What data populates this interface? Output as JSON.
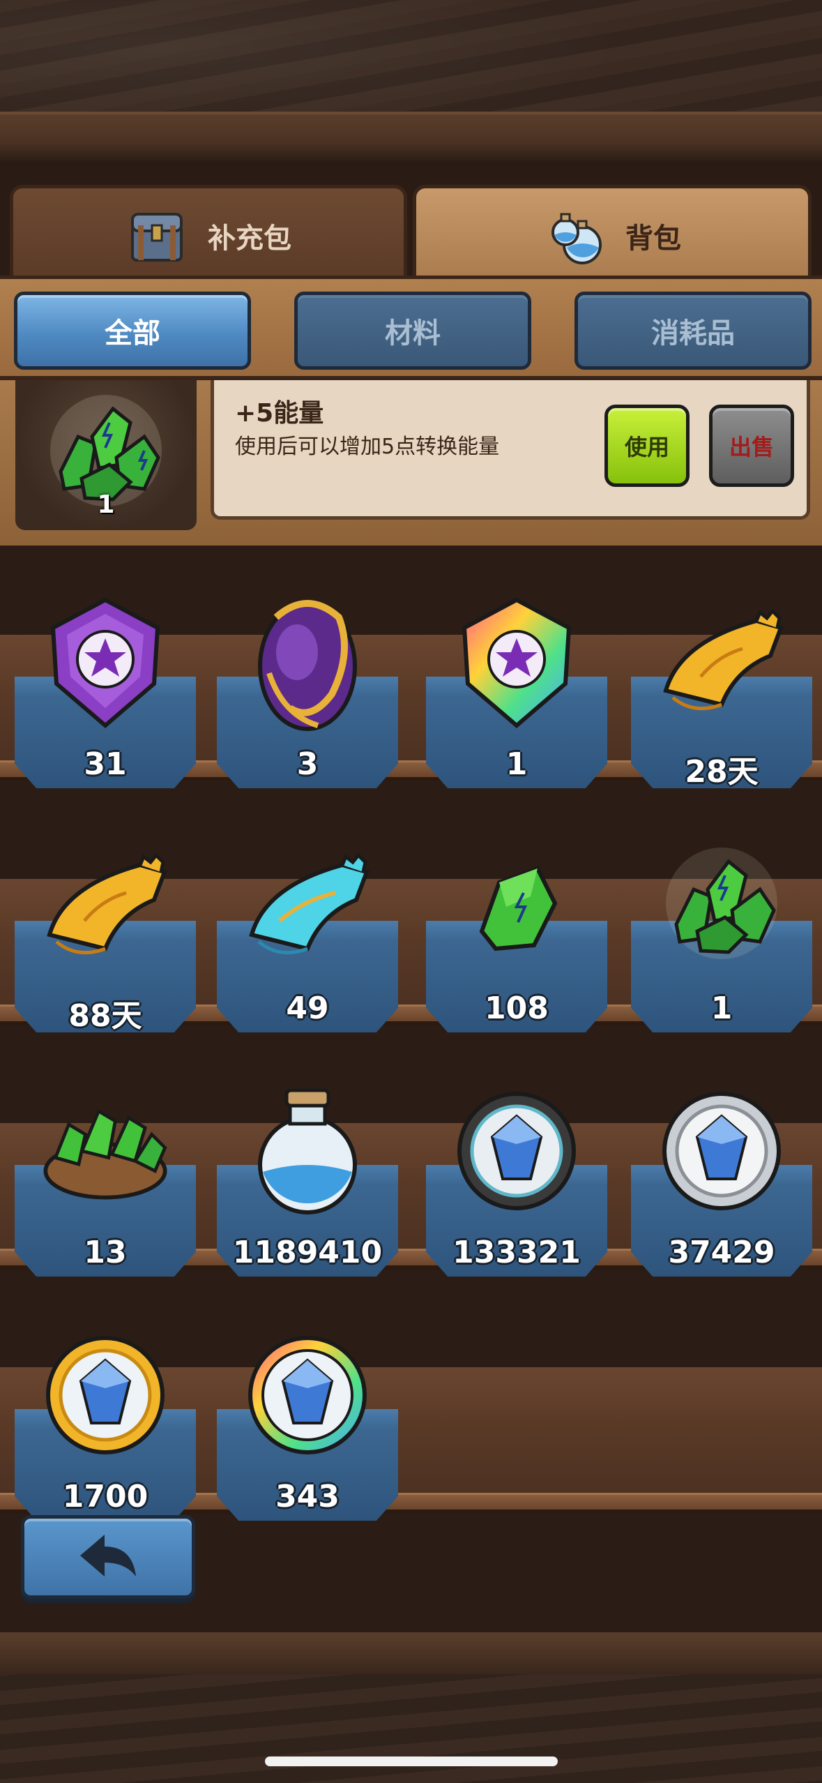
{
  "tabs": {
    "supply_label": "补充包",
    "bag_label": "背包",
    "active": "背包"
  },
  "filters": [
    {
      "label": "全部",
      "active": true
    },
    {
      "label": "材料",
      "active": false
    },
    {
      "label": "消耗品",
      "active": false
    }
  ],
  "detail": {
    "icon": "green-crystal-pile-icon",
    "count": "1",
    "title": "+5能量",
    "description": "使用后可以增加5点转换能量",
    "use_label": "使用",
    "sell_label": "出售"
  },
  "items": [
    {
      "icon": "purple-star-gem-icon",
      "count": "31"
    },
    {
      "icon": "purple-egg-icon",
      "count": "3"
    },
    {
      "icon": "rainbow-star-gem-icon",
      "count": "1"
    },
    {
      "icon": "gold-ticket-icon",
      "count": "28天"
    },
    {
      "icon": "gold-ticket-icon",
      "count": "88天"
    },
    {
      "icon": "blue-ticket-icon",
      "count": "49"
    },
    {
      "icon": "green-crystal-icon",
      "count": "108"
    },
    {
      "icon": "green-crystal-pile-icon",
      "count": "1"
    },
    {
      "icon": "crystal-sack-icon",
      "count": "13"
    },
    {
      "icon": "blue-potion-icon",
      "count": "1189410"
    },
    {
      "icon": "dark-diamond-coin-icon",
      "count": "133321"
    },
    {
      "icon": "silver-diamond-coin-icon",
      "count": "37429"
    },
    {
      "icon": "gold-diamond-coin-icon",
      "count": "1700"
    },
    {
      "icon": "rainbow-diamond-coin-icon",
      "count": "343"
    }
  ],
  "back_button": {
    "icon": "back-arrow-icon"
  }
}
